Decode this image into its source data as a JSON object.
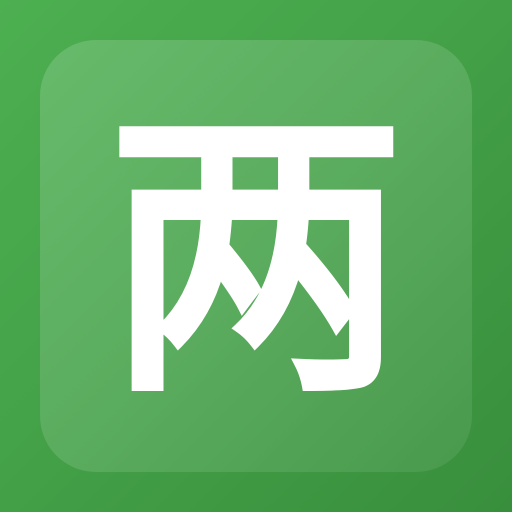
{
  "app_icon": {
    "glyph": "两",
    "colors": {
      "background": "#43a047",
      "glyph": "#ffffff"
    }
  }
}
